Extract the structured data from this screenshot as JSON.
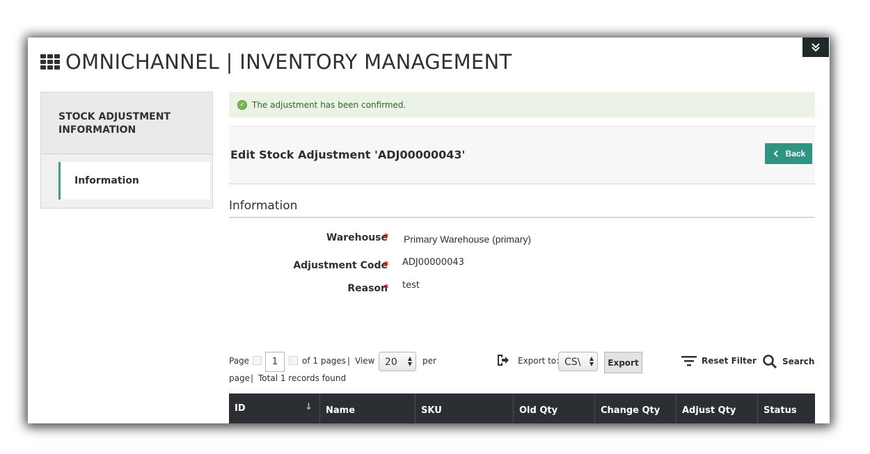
{
  "app": {
    "title": "OMNICHANNEL | INVENTORY MANAGEMENT"
  },
  "sidebar": {
    "heading": "STOCK ADJUSTMENT INFORMATION",
    "items": [
      {
        "label": "Information"
      }
    ]
  },
  "message": {
    "success": "The adjustment has been confirmed."
  },
  "page": {
    "title": "Edit Stock Adjustment 'ADJ00000043'",
    "back_label": "Back"
  },
  "section": {
    "title": "Information"
  },
  "form": {
    "warehouse_label": "Warehouse",
    "warehouse_value": "Primary Warehouse (primary)",
    "code_label": "Adjustment Code",
    "code_value": "ADJ00000043",
    "reason_label": "Reason",
    "reason_value": "test",
    "required_mark": "*"
  },
  "grid_toolbar": {
    "page_label": "Page",
    "page_value": "1",
    "of_pages": "of 1 pages",
    "separator": "|",
    "view_label": "View",
    "view_value": "20",
    "per_label": "per",
    "page_word": "page",
    "total_records": "Total 1 records found",
    "export_to_label": "Export to:",
    "export_format": "CS\\",
    "export_button": "Export",
    "reset_filter": "Reset Filter",
    "search": "Search"
  },
  "table": {
    "columns": [
      "ID",
      "Name",
      "SKU",
      "Old Qty",
      "Change Qty",
      "Adjust Qty",
      "Status"
    ]
  }
}
